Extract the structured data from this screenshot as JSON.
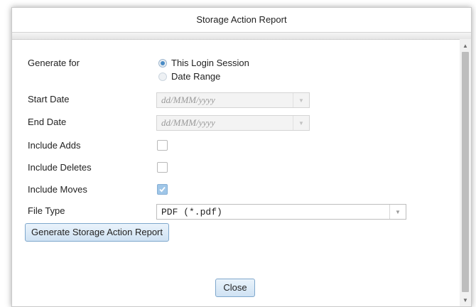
{
  "dialog": {
    "title": "Storage Action Report"
  },
  "form": {
    "generate_for_label": "Generate for",
    "option_session": "This Login Session",
    "option_date_range": "Date Range",
    "start_date_label": "Start Date",
    "start_date_placeholder": "dd/MMM/yyyy",
    "end_date_label": "End Date",
    "end_date_placeholder": "dd/MMM/yyyy",
    "include_adds_label": "Include Adds",
    "include_adds_checked": false,
    "include_deletes_label": "Include Deletes",
    "include_deletes_checked": false,
    "include_moves_label": "Include Moves",
    "include_moves_checked": true,
    "file_type_label": "File Type",
    "file_type_value": "PDF (*.pdf)"
  },
  "buttons": {
    "generate_label": "Generate Storage Action Report",
    "close_label": "Close"
  },
  "icons": {
    "dropdown": "chevron-down-icon",
    "checkmark": "check-icon",
    "scroll_up": "scroll-up-arrow-icon",
    "scroll_down": "scroll-down-arrow-icon"
  },
  "colors": {
    "button_border": "#7ea7cc",
    "button_fill": "#cfe2f3",
    "radio_selected": "#4a8bc5",
    "checkbox_checked": "#9fc6e8"
  }
}
